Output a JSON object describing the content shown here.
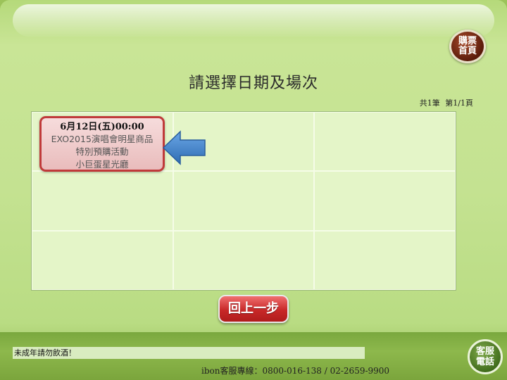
{
  "home_button": {
    "line1": "購票",
    "line2": "首頁"
  },
  "page_title": "請選擇日期及場次",
  "pager": {
    "total": "共1筆",
    "page": "第1/1頁"
  },
  "sessions": [
    {
      "date": "6月12日(五)00:00",
      "event": "EXO2015演唱會明星商品",
      "subtitle": "特別預購活動",
      "venue": "小巨蛋星光廳"
    }
  ],
  "back_button": "回上一步",
  "ticker": "未成年請勿飲酒！",
  "hotline": "ibon客服專線：0800-016-138 / 02-2659-9900",
  "cs_button": {
    "line1": "客服",
    "line2": "電話"
  },
  "colors": {
    "session_border": "#c03a3a",
    "arrow": "#3e7fc4",
    "back_button": "#c82828"
  }
}
